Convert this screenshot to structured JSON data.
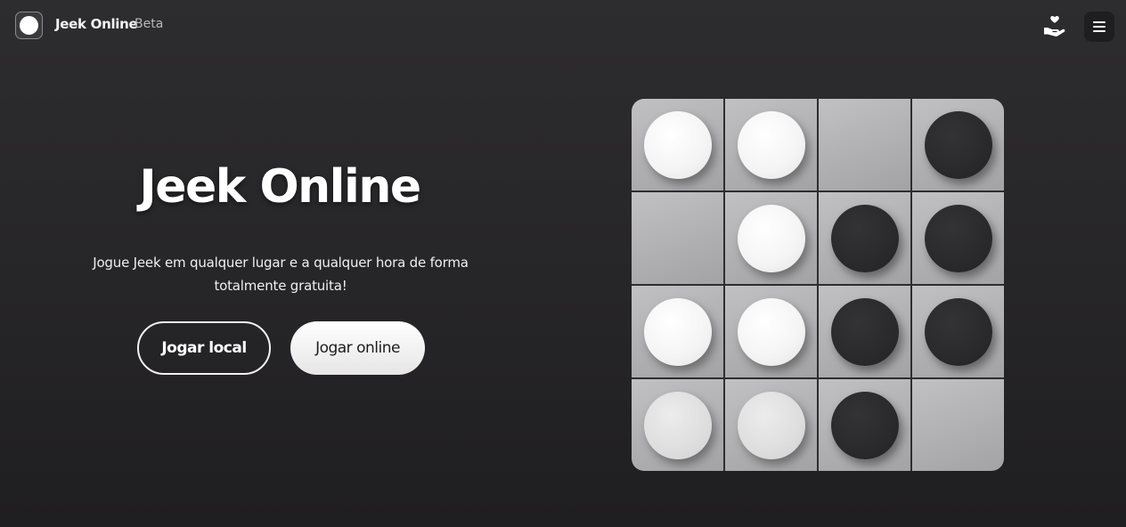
{
  "header": {
    "brand": "Jeek Online",
    "badge": "Beta",
    "logo_icon": "jeek-logo-icon",
    "donate_icon": "hand-heart-icon",
    "menu_icon": "hamburger-menu-icon"
  },
  "hero": {
    "title": "Jeek Online",
    "subtitle": "Jogue Jeek em qualquer lugar e a qualquer hora de forma totalmente gratuita!",
    "local_button": "Jogar local",
    "online_button": "Jogar online"
  },
  "board": {
    "rows": [
      [
        "white",
        "white",
        "empty",
        "black"
      ],
      [
        "empty",
        "white",
        "black",
        "black"
      ],
      [
        "white",
        "white",
        "black",
        "black"
      ],
      [
        "white-dim",
        "white-dim",
        "black",
        "empty"
      ]
    ]
  },
  "colors": {
    "background": "#262527",
    "cell": "#b2b1b3",
    "white_piece": "#ffffff",
    "black_piece": "#2a292b"
  }
}
